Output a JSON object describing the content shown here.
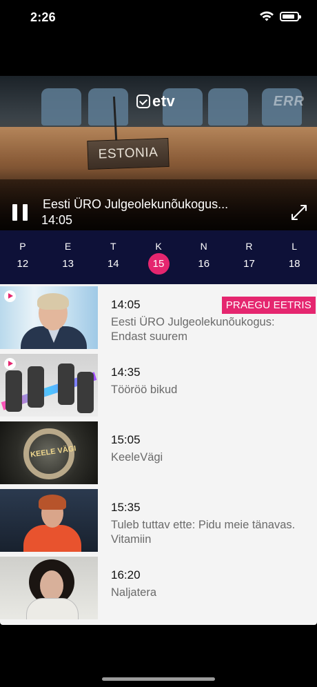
{
  "status_bar": {
    "time": "2:26"
  },
  "player": {
    "channel_logo": "etv",
    "watermark": "ERR",
    "scene_plate": "ESTONIA",
    "now_title": "Eesti ÜRO Julgeolekunõukogus...",
    "now_time": "14:05",
    "icons": {
      "pause": "pause-icon",
      "fullscreen": "fullscreen-icon"
    }
  },
  "days": [
    {
      "letter": "P",
      "number": "12"
    },
    {
      "letter": "E",
      "number": "13"
    },
    {
      "letter": "T",
      "number": "14"
    },
    {
      "letter": "K",
      "number": "15",
      "active": true
    },
    {
      "letter": "N",
      "number": "16"
    },
    {
      "letter": "R",
      "number": "17"
    },
    {
      "letter": "L",
      "number": "18"
    }
  ],
  "schedule": [
    {
      "time": "14:05",
      "title": "Eesti ÜRO Julgeolekunõukogus: Endast suurem",
      "badge": "PRAEGU EETRIS",
      "playable": true
    },
    {
      "time": "14:35",
      "title": "Tööröö bikud",
      "playable": true
    },
    {
      "time": "15:05",
      "title": "KeeleVägi",
      "thumb_text": "KEELE VÄGI",
      "playable": false
    },
    {
      "time": "15:35",
      "title": "Tuleb tuttav ette:  Pidu meie tänavas. Vitamiin",
      "playable": false
    },
    {
      "time": "16:20",
      "title": "Naljatera",
      "playable": false
    }
  ],
  "colors": {
    "accent": "#e5266f",
    "day_strip": "#0e1138",
    "list_bg": "#f4f4f4"
  }
}
